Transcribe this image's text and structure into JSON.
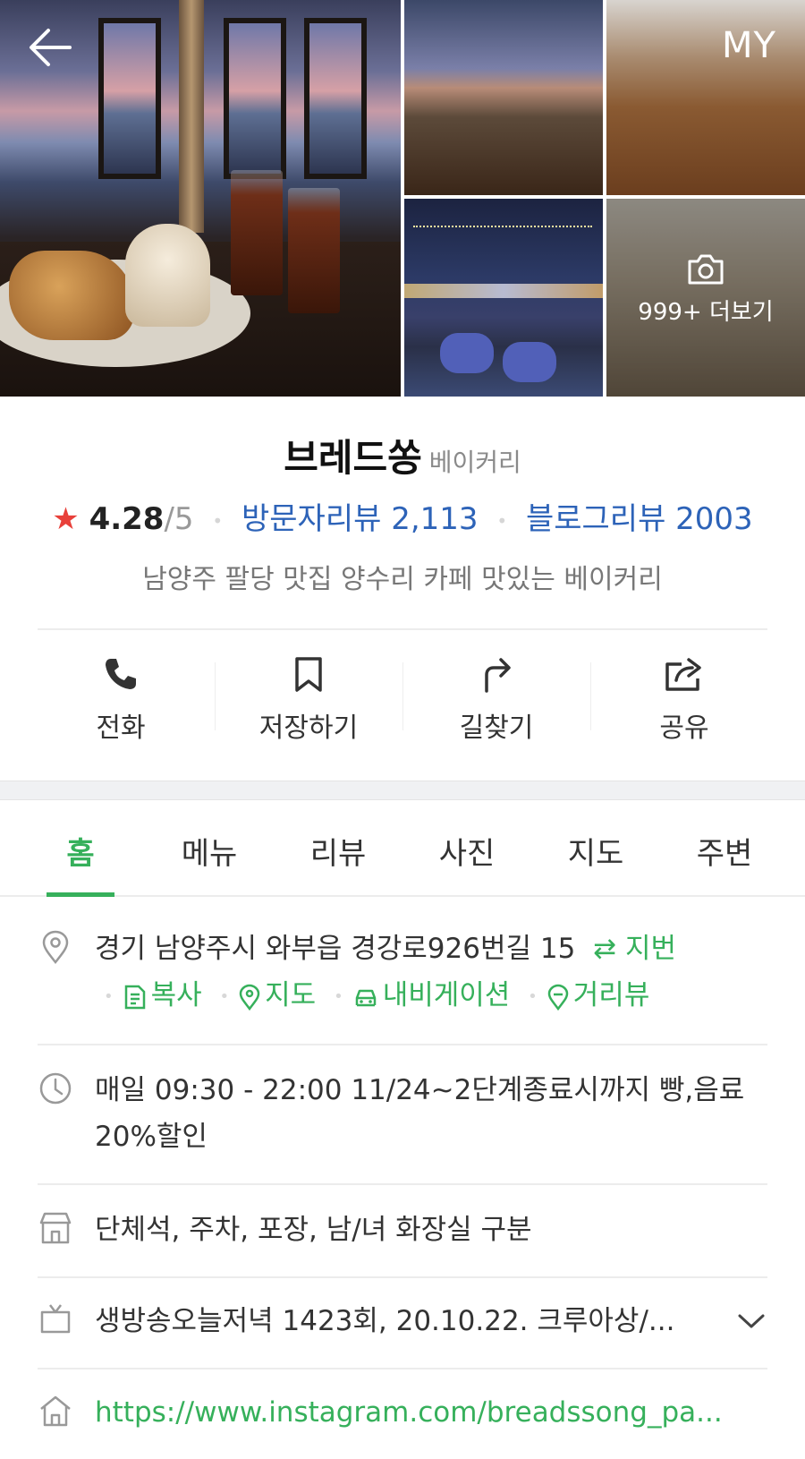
{
  "nav": {
    "my_label": "MY"
  },
  "gallery": {
    "more_label": "999+ 더보기"
  },
  "place": {
    "name": "브레드쏭",
    "category": "베이커리",
    "rating": "4.28",
    "rating_max": "/5",
    "visitor_reviews": "방문자리뷰 2,113",
    "blog_reviews": "블로그리뷰 2003",
    "description": "남양주 팔당 맛집 양수리 카페 맛있는 베이커리"
  },
  "actions": [
    {
      "label": "전화",
      "icon": "phone-icon"
    },
    {
      "label": "저장하기",
      "icon": "bookmark-icon"
    },
    {
      "label": "길찾기",
      "icon": "directions-icon"
    },
    {
      "label": "공유",
      "icon": "share-icon"
    }
  ],
  "tabs": [
    {
      "label": "홈",
      "active": true
    },
    {
      "label": "메뉴"
    },
    {
      "label": "리뷰"
    },
    {
      "label": "사진"
    },
    {
      "label": "지도"
    },
    {
      "label": "주변"
    }
  ],
  "info": {
    "address": "경기 남양주시 와부읍 경강로926번길 15",
    "address_toggle": "지번",
    "address_links": {
      "copy": "복사",
      "map": "지도",
      "navigation": "내비게이션",
      "street_view": "거리뷰"
    },
    "hours": "매일 09:30 - 22:00 11/24~2단계종료시까지 빵,음료20%할인",
    "facilities": "단체석, 주차, 포장, 남/녀 화장실 구분",
    "tv": "생방송오늘저녁 1423회, 20.10.22. 크루아상/...",
    "homepage": "https://www.instagram.com/breadssong_pa..."
  },
  "colors": {
    "accent_green": "#36b05b",
    "link_blue": "#2d63b8",
    "star_red": "#e8403a"
  }
}
